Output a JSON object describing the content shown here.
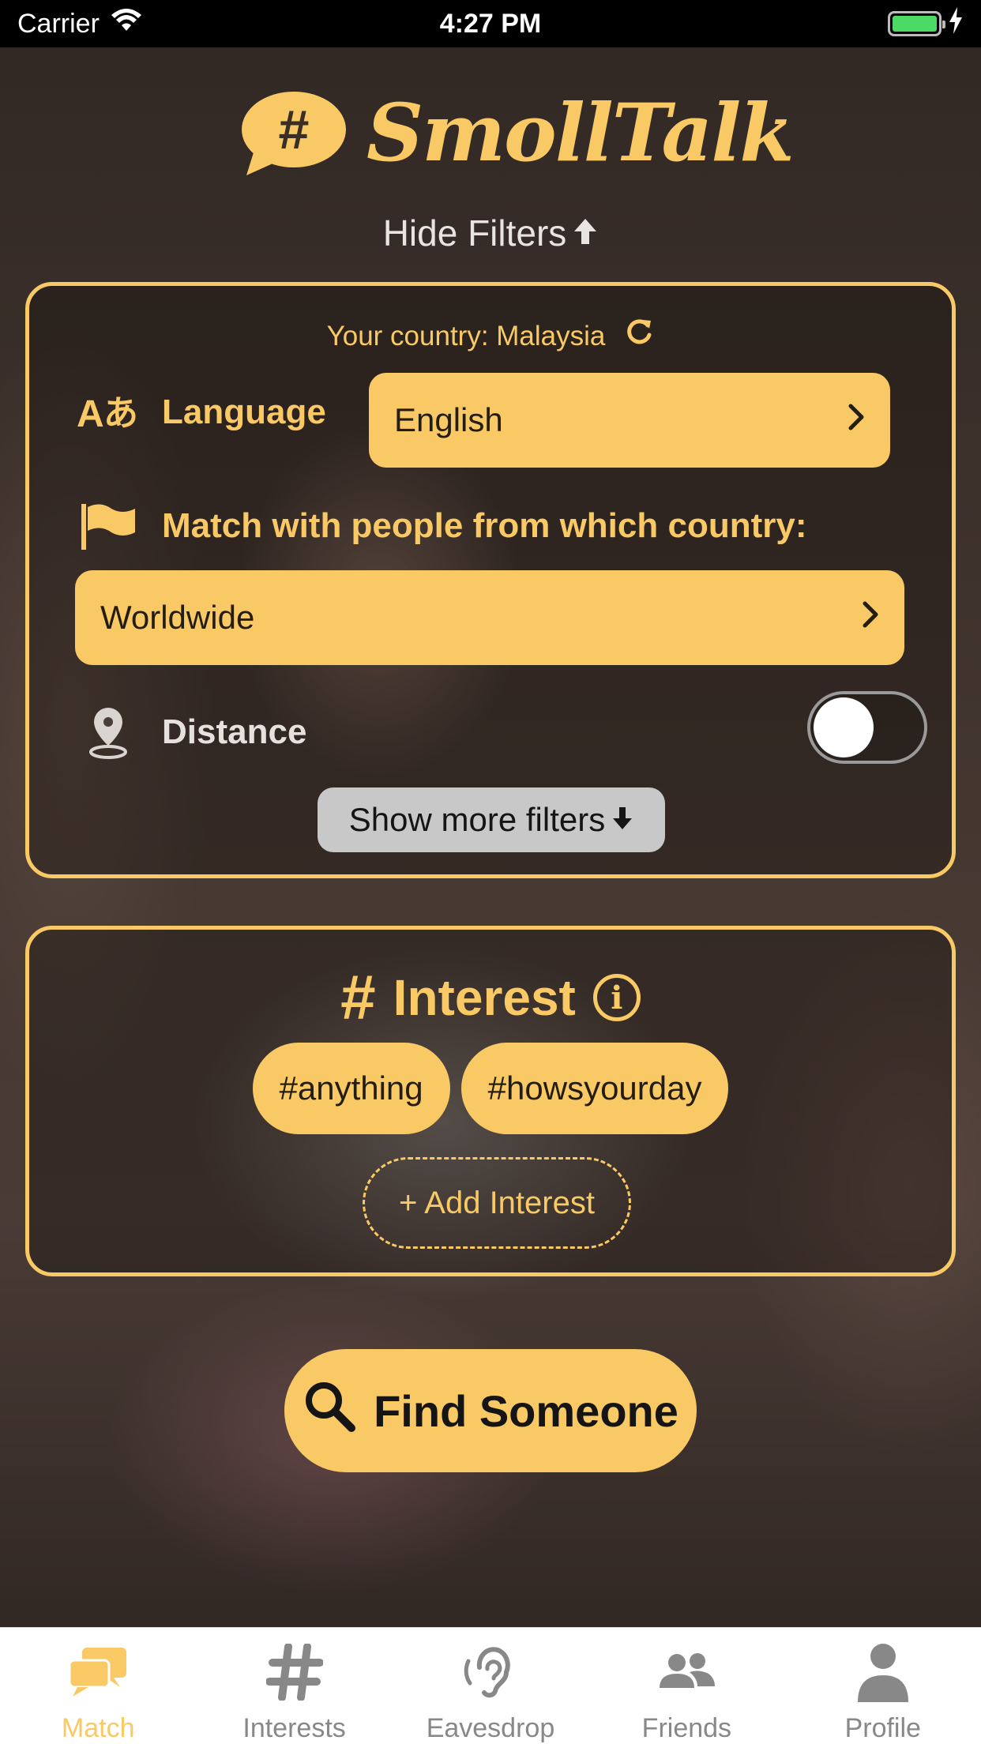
{
  "status_bar": {
    "carrier": "Carrier",
    "time": "4:27 PM"
  },
  "app": {
    "title": "SmollTalk",
    "logo_symbol": "#"
  },
  "colors": {
    "accent": "#f9c965",
    "tab_inactive": "#888888",
    "toggle_off": "#9a9a9a"
  },
  "header": {
    "hide_filters": "Hide Filters"
  },
  "filters": {
    "country_line": "Your country: Malaysia",
    "language_label": "Language",
    "language_value": "English",
    "match_country_label": "Match with people from which country:",
    "match_country_value": "Worldwide",
    "distance_label": "Distance",
    "distance_enabled": false,
    "show_more": "Show more filters"
  },
  "interest": {
    "title": "Interest",
    "hash": "#",
    "info": "i",
    "tags": [
      "#anything",
      "#howsyourday"
    ],
    "add": "+ Add Interest"
  },
  "find_button": "Find Someone",
  "tabs": [
    {
      "label": "Match",
      "icon": "chat-bubbles-icon",
      "active": true
    },
    {
      "label": "Interests",
      "icon": "hashtag-icon",
      "active": false
    },
    {
      "label": "Eavesdrop",
      "icon": "ear-icon",
      "active": false
    },
    {
      "label": "Friends",
      "icon": "people-icon",
      "active": false
    },
    {
      "label": "Profile",
      "icon": "person-icon",
      "active": false
    }
  ]
}
